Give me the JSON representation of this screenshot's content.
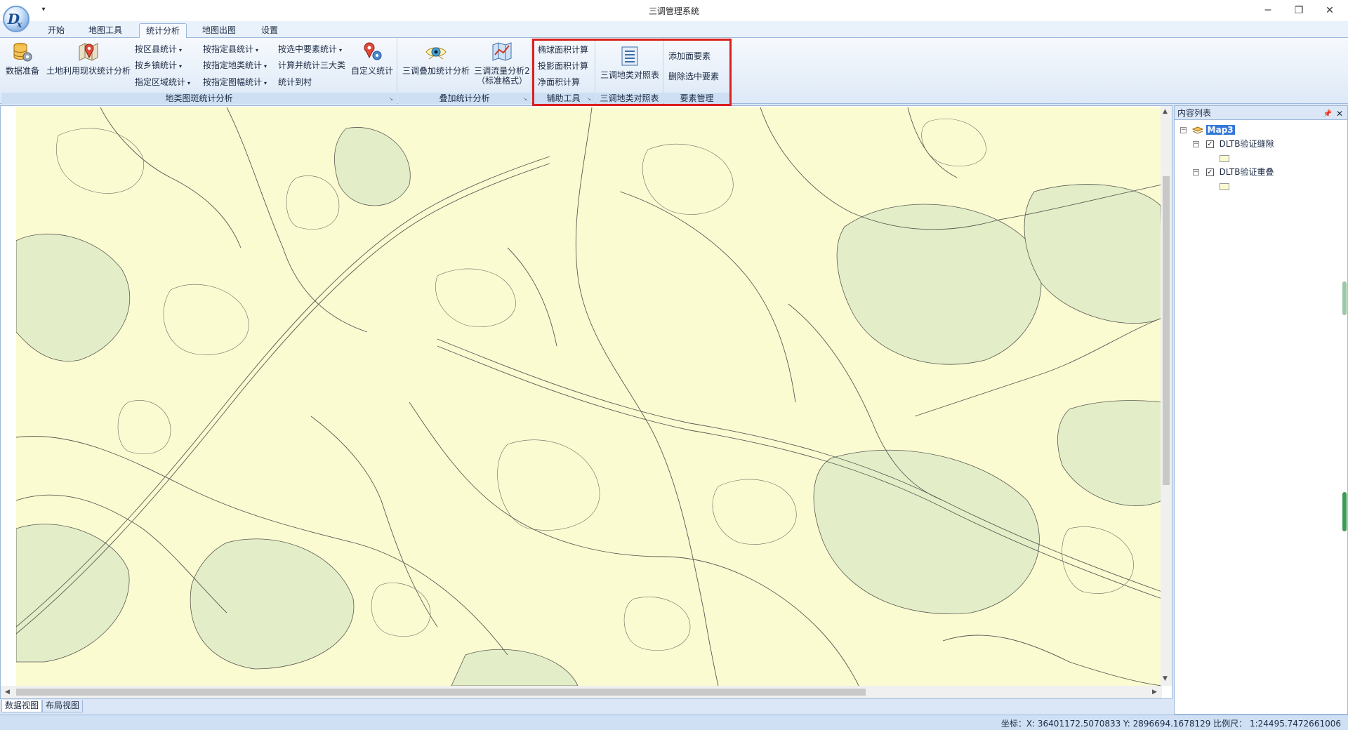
{
  "window": {
    "title": "三调管理系统",
    "minimize": "─",
    "restore": "❐",
    "close": "✕",
    "qat_icon": "▾"
  },
  "app_logo": {
    "icon": "dx-logo",
    "text": "D"
  },
  "tabs": [
    {
      "label": "开始"
    },
    {
      "label": "地图工具"
    },
    {
      "label": "统计分析"
    },
    {
      "label": "地图出图"
    },
    {
      "label": "设置"
    }
  ],
  "ribbon": {
    "group1": {
      "label": "地类图斑统计分析",
      "data_prep": "数据准备",
      "land_use": "土地利用现状统计分析",
      "by_district": "按区县统计",
      "by_town": "按乡镇统计",
      "by_region": "指定区域统计",
      "by_county": "按指定县统计",
      "by_landtype": "按指定地类统计",
      "by_sheet": "按指定图幅统计",
      "by_selection": "按选中要素统计",
      "calc_three": "计算并统计三大类",
      "to_village": "统计到村",
      "custom": "自定义统计"
    },
    "group2": {
      "label": "叠加统计分析",
      "overlay": "三调叠加统计分析",
      "flow_line1": "三调流量分析2",
      "flow_line2": "（标准格式）"
    },
    "group3": {
      "label": "辅助工具",
      "ellipsoid": "椭球面积计算",
      "projected": "投影面积计算",
      "net": "净面积计算"
    },
    "group4": {
      "label": "三调地类对照表",
      "table": "三调地类对照表"
    },
    "group5": {
      "label": "要素管理",
      "add": "添加面要素",
      "delete": "删除选中要素"
    }
  },
  "view_tabs": [
    {
      "label": "数据视图"
    },
    {
      "label": "布局视图"
    }
  ],
  "side_panel": {
    "title": "内容列表",
    "map_node": "Map3",
    "layers": [
      {
        "label": "DLTB验证缝隙",
        "checked": true
      },
      {
        "label": "DLTB验证重叠",
        "checked": true
      }
    ]
  },
  "status": {
    "text": "坐标：X: 36401172.5070833 Y: 2896694.1678129 比例尺： 1:24495.7472661006"
  },
  "colors": {
    "map_fill": "#fbfbd2",
    "map_green": "#e3eec8",
    "map_lines": "#5a5a52",
    "highlight": "#d9201c",
    "tree_selected": "#3478d8"
  }
}
